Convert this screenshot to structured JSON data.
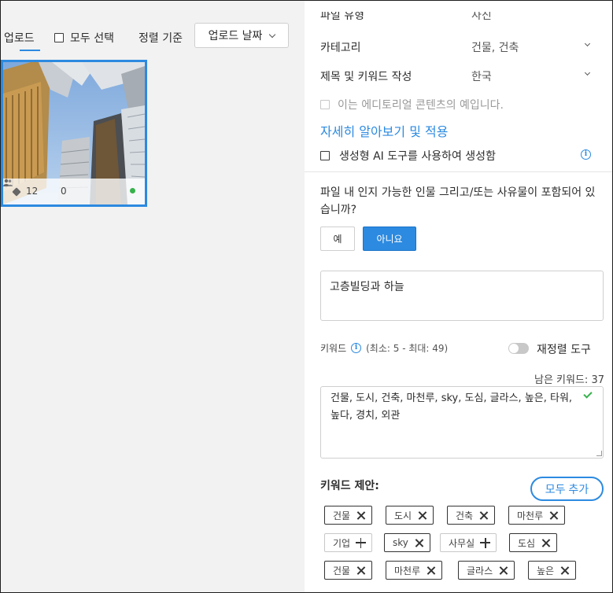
{
  "toolbar": {
    "upload_tab": "업로드",
    "select_all": "모두 선택",
    "sort_label": "정렬 기준",
    "sort_value": "업로드 날짜"
  },
  "thumbnail": {
    "tag_count": "12",
    "people_count": "0",
    "status": "green"
  },
  "panel": {
    "cut_label": "파일 유형",
    "cut_value": "사진",
    "category_label": "카테고리",
    "category_value": "건물, 건축",
    "language_label": "제목 및 키워드 작성",
    "language_value": "한국",
    "editorial_label": "이는 에디토리얼 콘텐츠의 예입니다.",
    "learn_more": "자세히 알아보기 및 적용",
    "genai_label": "생성형 AI 도구를 사용하여 생성함",
    "question": "파일 내 인지 가능한 인물 그리고/또는 사유물이 포함되어 있습니까?",
    "yes": "예",
    "no": "아니요",
    "title_value": "고층빌딩과 하늘",
    "keywords_label": "키워드",
    "keywords_range": "(최소: 5 - 최대: 49)",
    "reorder_label": "재정렬 도구",
    "remaining": "남은 키워드: 37",
    "keywords_value": "건물, 도시, 건축, 마천루, sky, 도심, 글라스, 높은, 타워, 높다, 경치, 외관",
    "suggest_title": "키워드 제안:",
    "add_all": "모두 추가"
  },
  "suggestions": [
    {
      "label": "건물",
      "action": "remove"
    },
    {
      "label": "도시",
      "action": "remove"
    },
    {
      "label": "건축",
      "action": "remove"
    },
    {
      "label": "마천루",
      "action": "remove"
    },
    {
      "label": "기업",
      "action": "add"
    },
    {
      "label": "sky",
      "action": "remove"
    },
    {
      "label": "사무실",
      "action": "add"
    },
    {
      "label": "도심",
      "action": "remove"
    },
    {
      "label": "건물",
      "action": "remove"
    },
    {
      "label": "마천루",
      "action": "remove"
    },
    {
      "label": "글라스",
      "action": "remove"
    },
    {
      "label": "높은",
      "action": "remove"
    }
  ],
  "colors": {
    "accent": "#2c8ae0",
    "status_green": "#37b24d"
  }
}
